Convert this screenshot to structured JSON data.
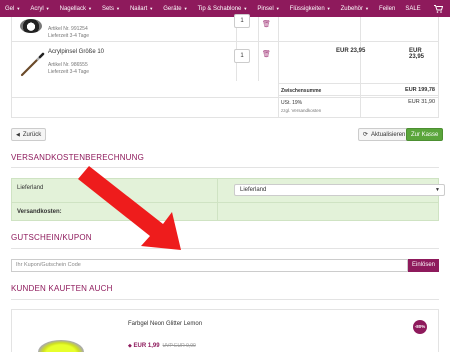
{
  "nav": {
    "items": [
      {
        "label": "Gel",
        "caret": true
      },
      {
        "label": "Acryl",
        "caret": true
      },
      {
        "label": "Nagellack",
        "caret": true
      },
      {
        "label": "Sets",
        "caret": true
      },
      {
        "label": "Nailart",
        "caret": true
      },
      {
        "label": "Geräte",
        "caret": true
      },
      {
        "label": "Tip & Schablone",
        "caret": true
      },
      {
        "label": "Pinsel",
        "caret": true
      },
      {
        "label": "Flüssigkeiten",
        "caret": true
      },
      {
        "label": "Zubehör",
        "caret": true
      },
      {
        "label": "Feilen",
        "caret": false
      },
      {
        "label": "SALE",
        "caret": false
      }
    ],
    "cart_icon": "shopping-cart-icon",
    "bg_color": "#8e1a5c"
  },
  "cart": {
    "items": [
      {
        "name": "",
        "article": "Artikel Nr. 991254",
        "delivery": "Lieferzeit 3-4 Tage",
        "qty": "1",
        "unit_price": "",
        "total_price": ""
      },
      {
        "name": "Acrylpinsel Größe 10",
        "article": "Artikel Nr. 986555",
        "delivery": "Lieferzeit 3-4 Tage",
        "qty": "1",
        "unit_price": "EUR 23,95",
        "total_price": "EUR 23,95"
      }
    ],
    "subtotal_label": "Zwischensumme",
    "subtotal_value": "EUR 199,78",
    "vat_label": "USt. 19%",
    "vat_note": "zzgl. Versandkosten",
    "vat_value": "EUR 31,90"
  },
  "actions": {
    "back": "Zurück",
    "refresh": "Aktualisieren",
    "checkout": "Zur Kasse"
  },
  "shipping": {
    "title": "VERSANDKOSTENBERECHNUNG",
    "country_label": "Lieferland",
    "country_select": "Lieferland",
    "cost_label": "Versandkosten:"
  },
  "coupon": {
    "title": "GUTSCHEIN/KUPON",
    "placeholder": "Ihr Kupon/Gutschein Code",
    "button": "Einlösen"
  },
  "recommend": {
    "title": "KUNDEN KAUFTEN AUCH",
    "product_name": "Farbgel Neon Glitter Lemon",
    "price": "EUR 1,99",
    "old_price": "UVP EUR 9,90",
    "discount": "-80%"
  },
  "colors": {
    "accent": "#8e1a5c",
    "success": "#5aa53b",
    "ship_bg": "#e3f2d9",
    "arrow": "#ee1c1c"
  }
}
